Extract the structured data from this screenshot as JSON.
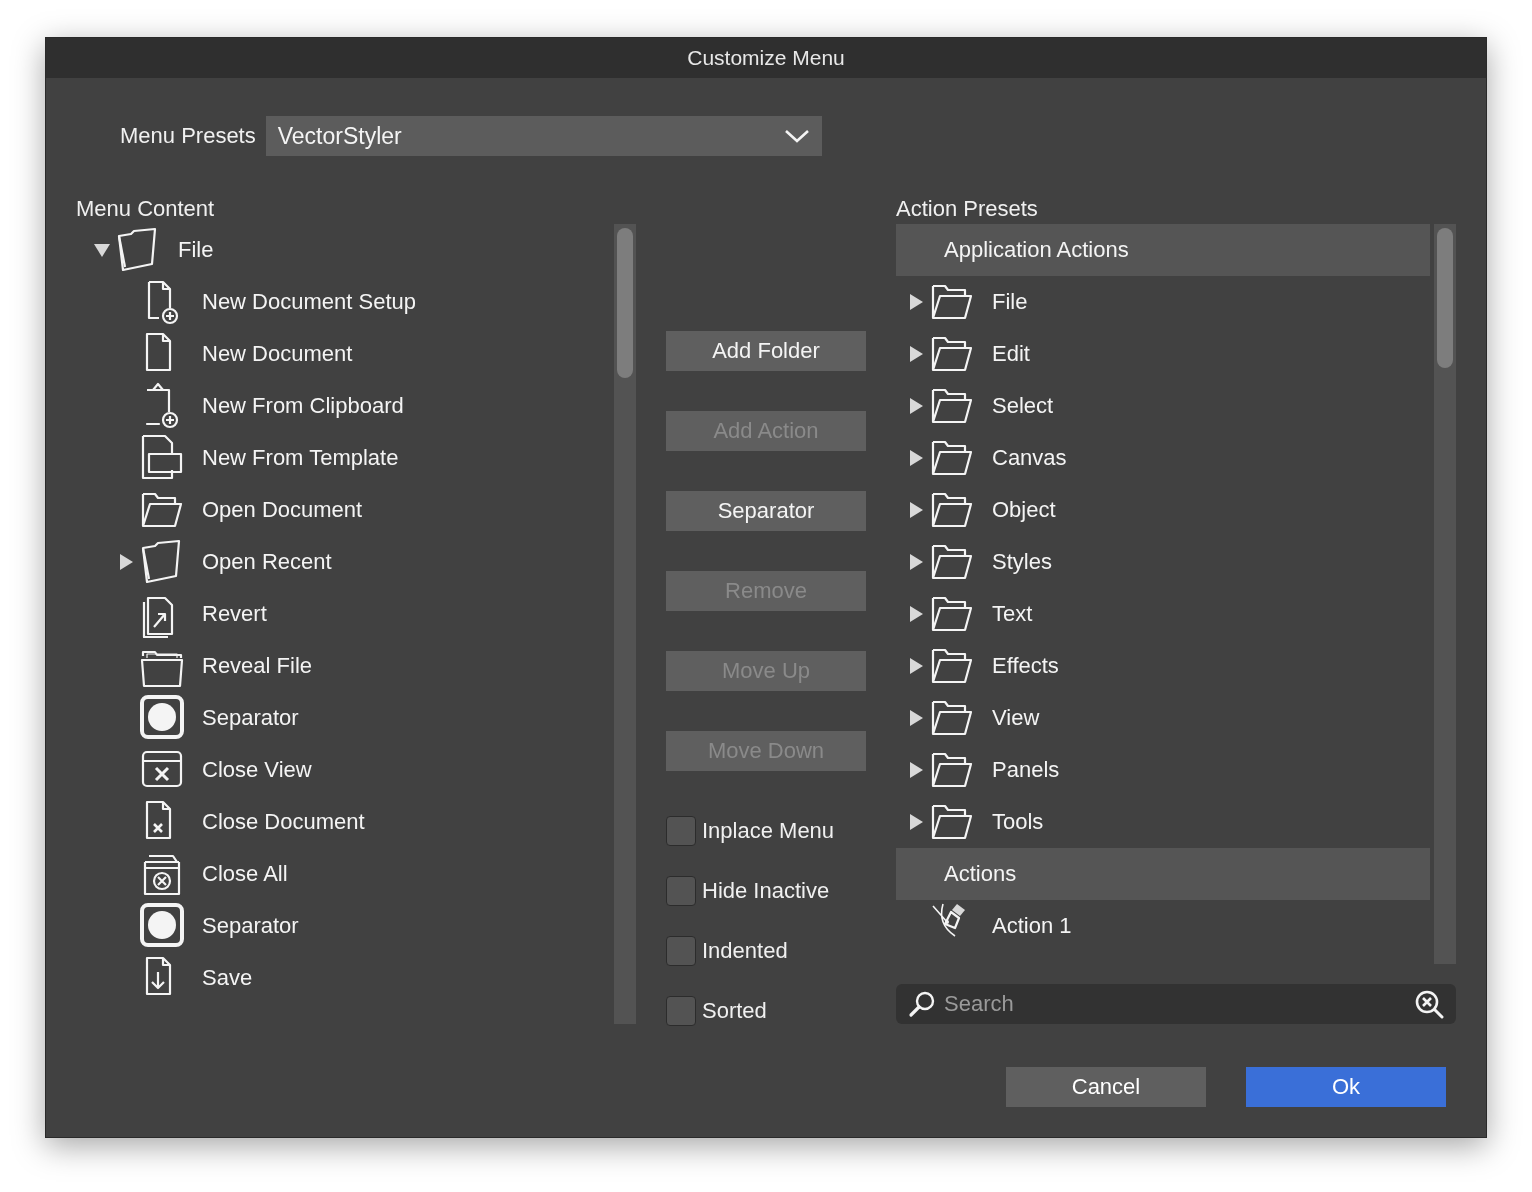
{
  "window": {
    "title": "Customize Menu"
  },
  "menu_presets": {
    "label": "Menu Presets",
    "value": "VectorStyler"
  },
  "menu_content": {
    "label": "Menu Content",
    "items": [
      {
        "label": "File",
        "kind": "folder",
        "expanded": true,
        "children": [
          {
            "label": "New Document Setup",
            "kind": "action"
          },
          {
            "label": "New Document",
            "kind": "action"
          },
          {
            "label": "New From Clipboard",
            "kind": "action"
          },
          {
            "label": "New From Template",
            "kind": "action"
          },
          {
            "label": "Open Document",
            "kind": "action"
          },
          {
            "label": "Open Recent",
            "kind": "folder",
            "expanded": false
          },
          {
            "label": "Revert",
            "kind": "action"
          },
          {
            "label": "Reveal File",
            "kind": "action"
          },
          {
            "label": "Separator",
            "kind": "separator"
          },
          {
            "label": "Close View",
            "kind": "action"
          },
          {
            "label": "Close Document",
            "kind": "action"
          },
          {
            "label": "Close All",
            "kind": "action"
          },
          {
            "label": "Separator",
            "kind": "separator"
          },
          {
            "label": "Save",
            "kind": "action"
          }
        ]
      }
    ]
  },
  "buttons": [
    {
      "label": "Add Folder",
      "disabled": false
    },
    {
      "label": "Add Action",
      "disabled": true
    },
    {
      "label": "Separator",
      "disabled": false
    },
    {
      "label": "Remove",
      "disabled": true
    },
    {
      "label": "Move Up",
      "disabled": true
    },
    {
      "label": "Move Down",
      "disabled": true
    }
  ],
  "options": [
    {
      "label": "Inplace Menu",
      "checked": false
    },
    {
      "label": "Hide Inactive",
      "checked": false
    },
    {
      "label": "Indented",
      "checked": false
    },
    {
      "label": "Sorted",
      "checked": false
    }
  ],
  "action_presets": {
    "label": "Action Presets",
    "groups": [
      {
        "label": "Application Actions",
        "items": [
          {
            "label": "File",
            "kind": "folder",
            "expanded": false
          },
          {
            "label": "Edit",
            "kind": "folder",
            "expanded": false
          },
          {
            "label": "Select",
            "kind": "folder",
            "expanded": false
          },
          {
            "label": "Canvas",
            "kind": "folder",
            "expanded": false
          },
          {
            "label": "Object",
            "kind": "folder",
            "expanded": false
          },
          {
            "label": "Styles",
            "kind": "folder",
            "expanded": false
          },
          {
            "label": "Text",
            "kind": "folder",
            "expanded": false
          },
          {
            "label": "Effects",
            "kind": "folder",
            "expanded": false
          },
          {
            "label": "View",
            "kind": "folder",
            "expanded": false
          },
          {
            "label": "Panels",
            "kind": "folder",
            "expanded": false
          },
          {
            "label": "Tools",
            "kind": "folder",
            "expanded": false
          }
        ]
      },
      {
        "label": "Actions",
        "items": [
          {
            "label": "Action 1",
            "kind": "action"
          }
        ]
      }
    ]
  },
  "search": {
    "placeholder": "Search"
  },
  "footer": [
    {
      "label": "Cancel",
      "kind": "secondary"
    },
    {
      "label": "Ok",
      "kind": "primary"
    }
  ]
}
